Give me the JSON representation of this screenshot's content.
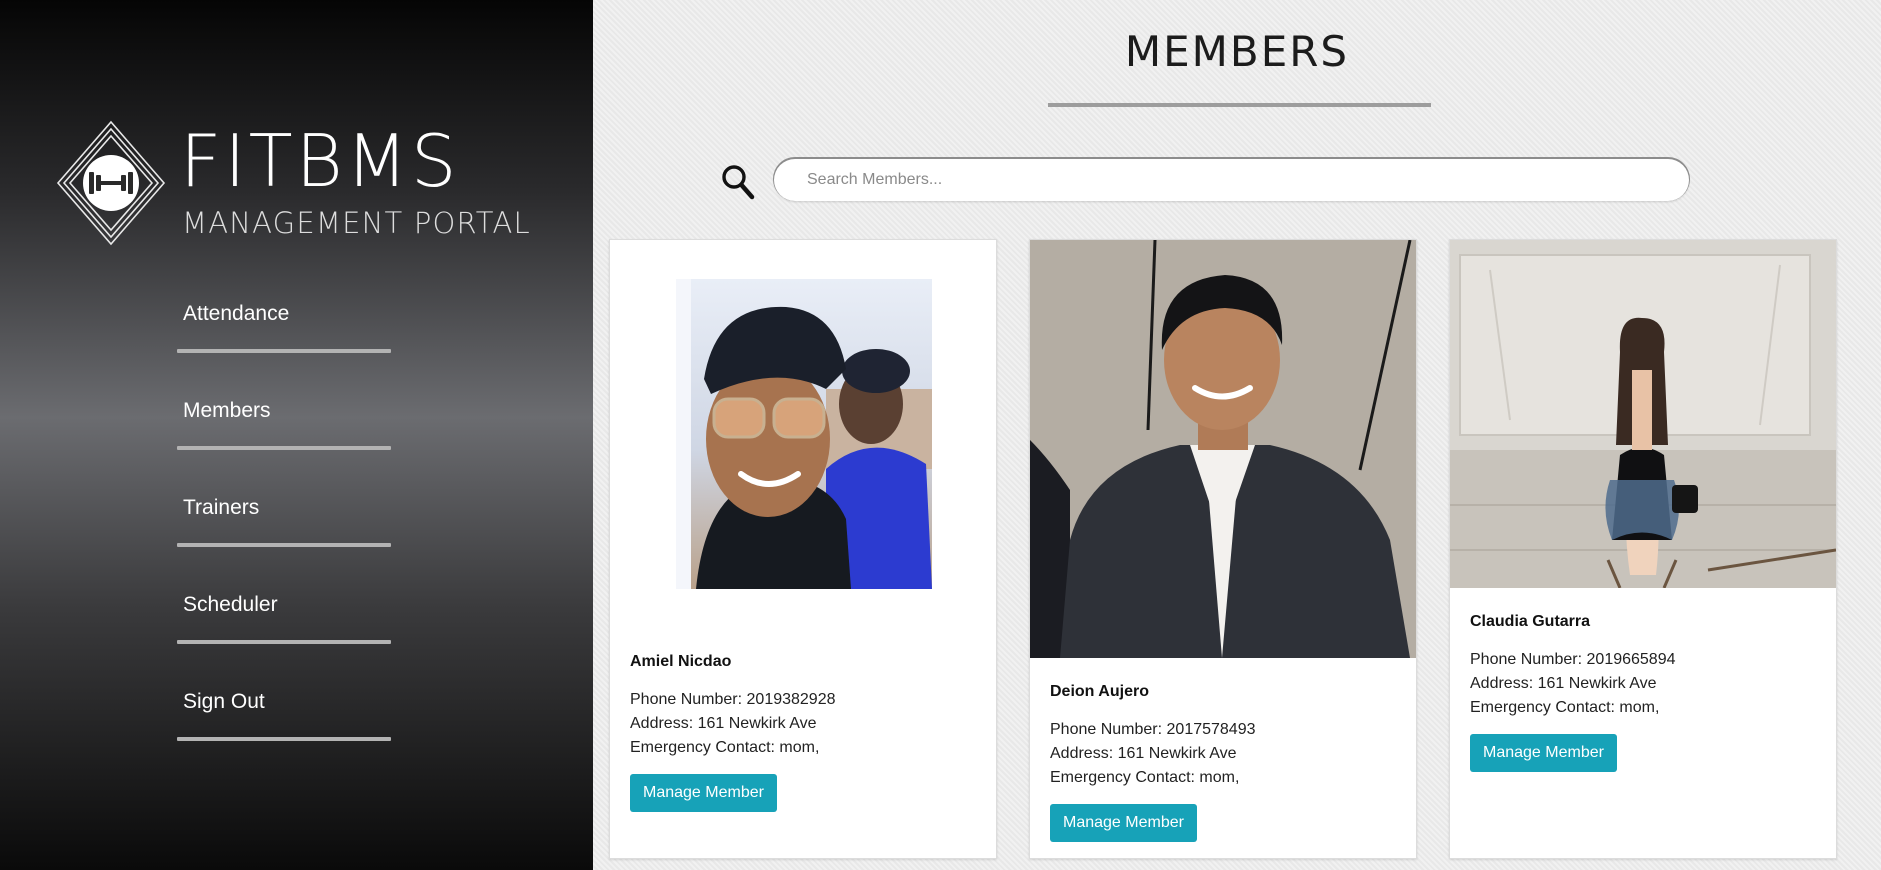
{
  "brand": {
    "title": "FITBMS",
    "subtitle": "MANAGEMENT PORTAL",
    "logo_icon": "dumbbell-icon"
  },
  "nav": {
    "items": [
      {
        "label": "Attendance"
      },
      {
        "label": "Members"
      },
      {
        "label": "Trainers"
      },
      {
        "label": "Scheduler"
      },
      {
        "label": "Sign Out"
      }
    ]
  },
  "page": {
    "title": "MEMBERS"
  },
  "search": {
    "icon": "search-icon",
    "placeholder": "Search Members...",
    "value": ""
  },
  "labels": {
    "phone": "Phone Number: ",
    "address": "Address: ",
    "emergency": "Emergency Contact: "
  },
  "members": [
    {
      "name": "Amiel Nicdao",
      "phone": "2019382928",
      "address": "161 Newkirk Ave",
      "emergency": "mom,",
      "button": "Manage Member"
    },
    {
      "name": "Deion Aujero",
      "phone": "2017578493",
      "address": "161 Newkirk Ave",
      "emergency": "mom,",
      "button": "Manage Member"
    },
    {
      "name": "Claudia Gutarra",
      "phone": "2019665894",
      "address": "161 Newkirk Ave",
      "emergency": "mom,",
      "button": "Manage Member"
    }
  ],
  "colors": {
    "accent": "#17a2b8",
    "sidebar_dark": "#050505",
    "sidebar_mid": "#6b6c70",
    "rule": "#9d9d9d"
  }
}
